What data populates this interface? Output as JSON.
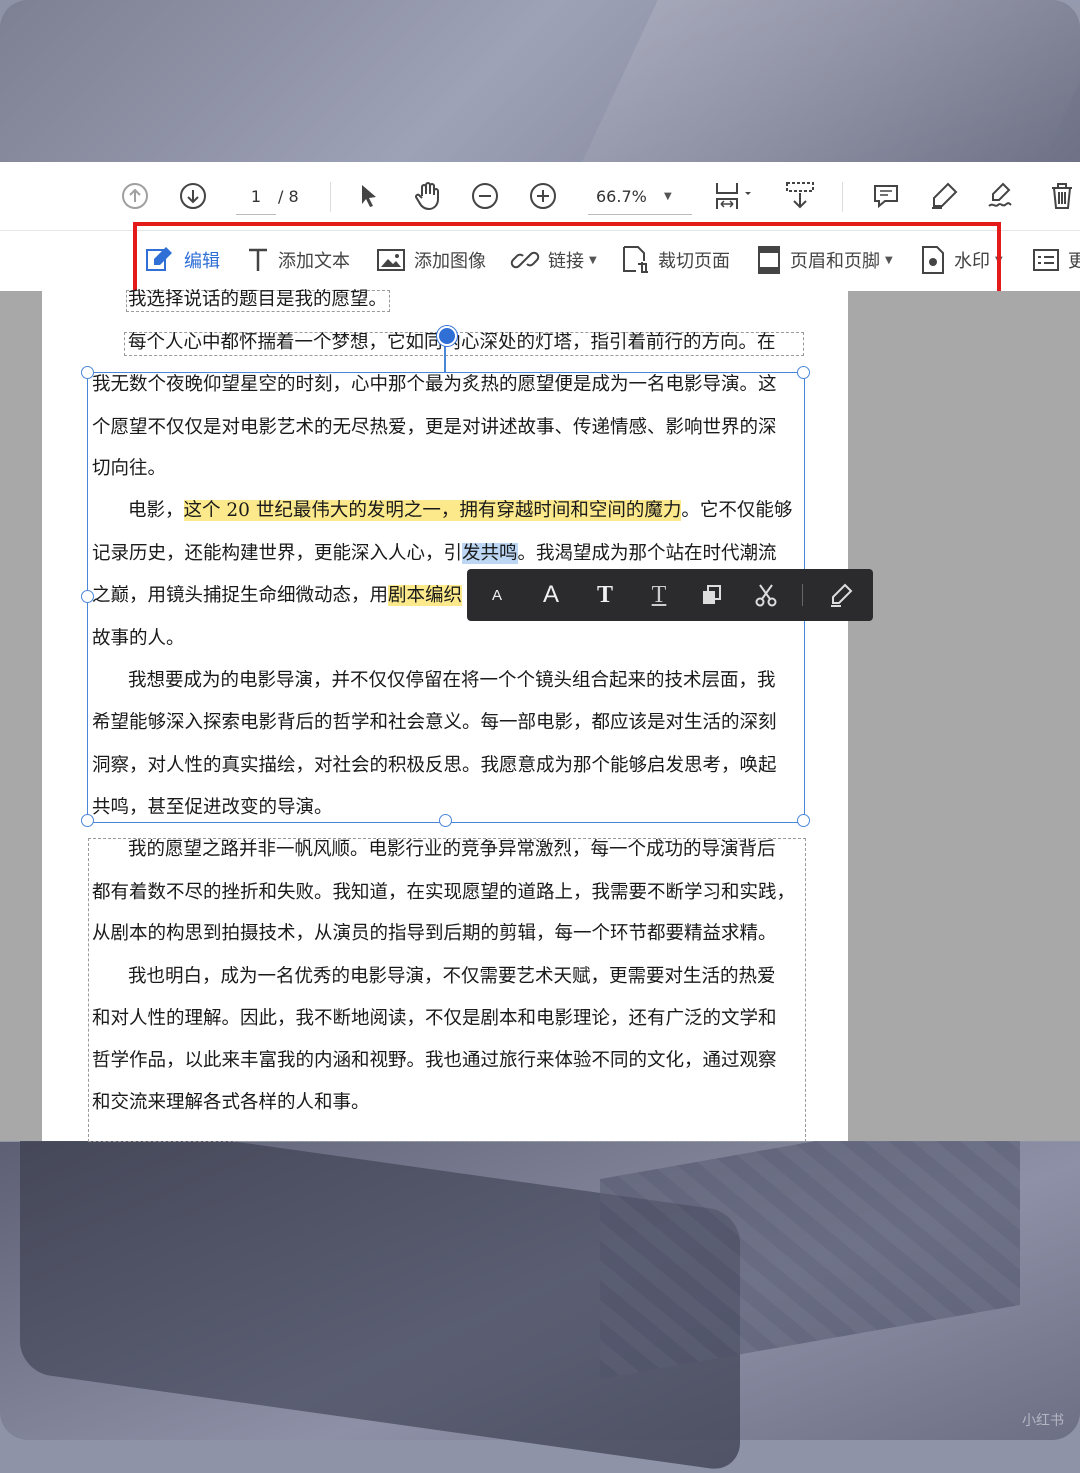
{
  "title_partial": "",
  "toolbar": {
    "page_current": "1",
    "page_total": "/ 8",
    "zoom": "66.7%",
    "icons": [
      "arrow-up-icon",
      "arrow-down-icon",
      "select-arrow-icon",
      "hand-icon",
      "zoom-out-icon",
      "zoom-in-icon",
      "fit-page-icon",
      "marquee-icon",
      "comment-icon",
      "highlight-pen-icon",
      "sign-icon",
      "delete-icon"
    ]
  },
  "edit_toolbar": {
    "items": [
      {
        "label": "编辑",
        "icon": "edit-icon",
        "active": true
      },
      {
        "label": "添加文本",
        "icon": "text-T-icon"
      },
      {
        "label": "添加图像",
        "icon": "image-icon"
      },
      {
        "label": "链接",
        "icon": "link-icon",
        "dropdown": true
      },
      {
        "label": "裁切页面",
        "icon": "crop-page-icon"
      },
      {
        "label": "页眉和页脚",
        "icon": "header-footer-icon",
        "dropdown": true
      },
      {
        "label": "水印",
        "icon": "watermark-icon",
        "dropdown": true
      },
      {
        "label": "更",
        "icon": "more-icon"
      }
    ],
    "highlight_color": "#e51b1b"
  },
  "document": {
    "lines": [
      "我选择说话的题目是我的愿望。",
      "每个人心中都怀揣着一个梦想，它如同内心深处的灯塔，指引着前行的方向。在",
      "我无数个夜晚仰望星空的时刻，心中那个最为炙热的愿望便是成为一名电影导演。这",
      "个愿望不仅仅是对电影艺术的无尽热爱，更是对讲述故事、传递情感、影响世界的深",
      "切向往。",
      "故事的人。",
      "我想要成为的电影导演，并不仅仅停留在将一个个镜头组合起来的技术层面，我",
      "希望能够深入探索电影背后的哲学和社会意义。每一部电影，都应该是对生活的深刻",
      "洞察，对人性的真实描绘，对社会的积极反思。我愿意成为那个能够启发思考，唤起",
      "共鸣，甚至促进改变的导演。",
      "我的愿望之路并非一帆风顺。电影行业的竞争异常激烈，每一个成功的导演背后",
      "都有着数不尽的挫折和失败。我知道，在实现愿望的道路上，我需要不断学习和实践，",
      "从剧本的构思到拍摄技术，从演员的指导到后期的剪辑，每一个环节都要精益求精。",
      "我也明白，成为一名优秀的电影导演，不仅需要艺术天赋，更需要对生活的热爱",
      "和对人性的理解。因此，我不断地阅读，不仅是剧本和电影理论，还有广泛的文学和",
      "哲学作品，以此来丰富我的内涵和视野。我也通过旅行来体验不同的文化，通过观察",
      "和交流来理解各式各样的人和事。"
    ],
    "line6_a": "电影，",
    "line6_hl": "这个 20 世纪最伟大的发明之一，拥有穿越时间和空间的魔力",
    "line6_b": "。它不仅能够",
    "line7_a": "记录历史，还能构建世界，更能深入人心，引",
    "line7_hl": "发共鸣",
    "line7_b": "。我渴望成为那个站在时代潮流",
    "line8_a": "之巅，用镜头捕捉生命细微动态，用",
    "line8_hl": "剧本编织"
  },
  "float_toolbar": {
    "small_a": "A",
    "large_a": "A",
    "bold_t": "T",
    "underline_t": "T",
    "icons": [
      "font-smaller-icon",
      "font-larger-icon",
      "bold-icon",
      "underline-icon",
      "copy-icon",
      "cut-icon",
      "edit-pen-icon"
    ]
  },
  "watermark": "小红书"
}
